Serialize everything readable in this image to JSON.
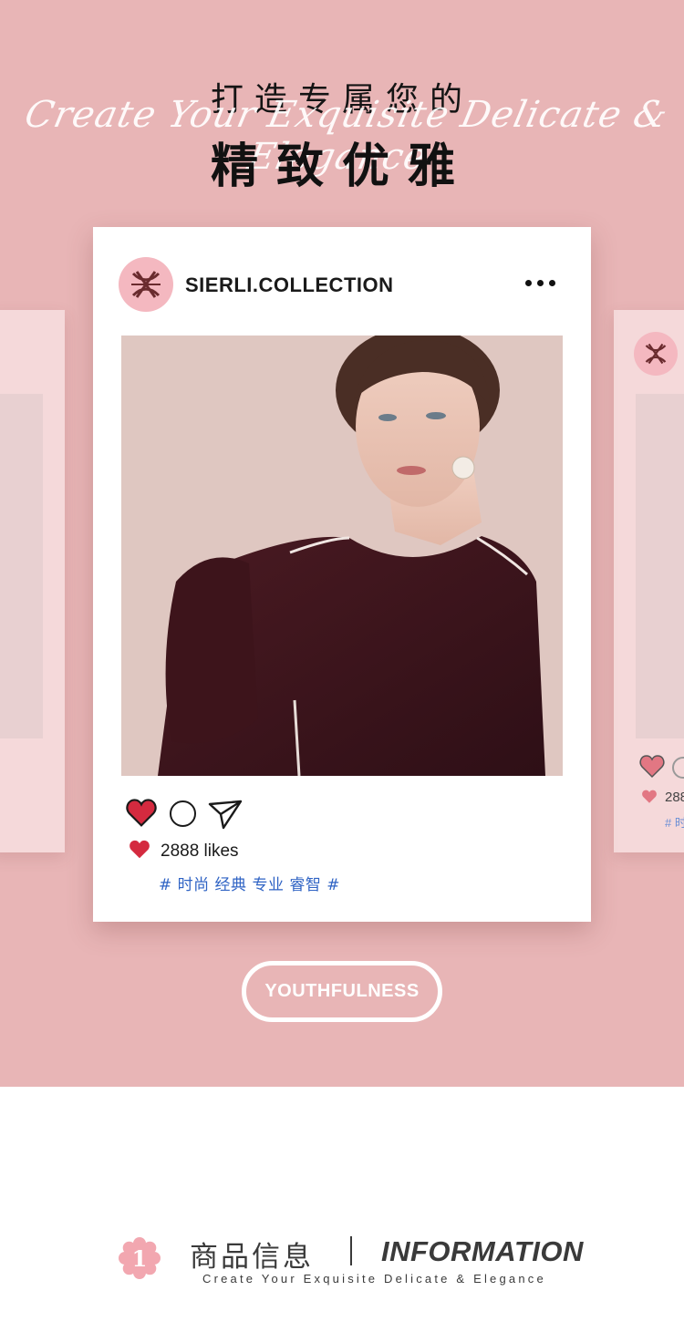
{
  "header": {
    "title_line1": "打造专属您的",
    "script_tagline": "Create Your Exquisite Delicate & Elegance",
    "title_line2": "精致优雅"
  },
  "post": {
    "account_name": "SIERLI.COLLECTION",
    "logo_icon": "sierli-monogram-icon",
    "more_icon": "more-dots-icon",
    "image_alt": "model-wearing-burgundy-blouse",
    "actions": [
      {
        "icon": "heart-icon",
        "color": "#d42a3f"
      },
      {
        "icon": "comment-icon"
      },
      {
        "icon": "share-icon"
      }
    ],
    "likes_count": "2888",
    "likes_text": "2888 likes",
    "hashtags": "# 时尚 经典 专业 睿智 #"
  },
  "ghost_right": {
    "likes_partial": "288",
    "tag_partial": "# 时"
  },
  "badge_pill": {
    "label": "YOUTHFULNESS"
  },
  "info_section": {
    "number": "1",
    "title_cn": "商品信息",
    "title_en": "INFORMATION",
    "subtitle": "Create Your Exquisite Delicate & Elegance"
  },
  "colors": {
    "hero_background": "#e8b5b6",
    "heart_red": "#d42a3f",
    "hashtag_blue": "#2f63c4",
    "logo_pink": "#f4b8c0",
    "badge_pink": "#f2a7b0"
  }
}
